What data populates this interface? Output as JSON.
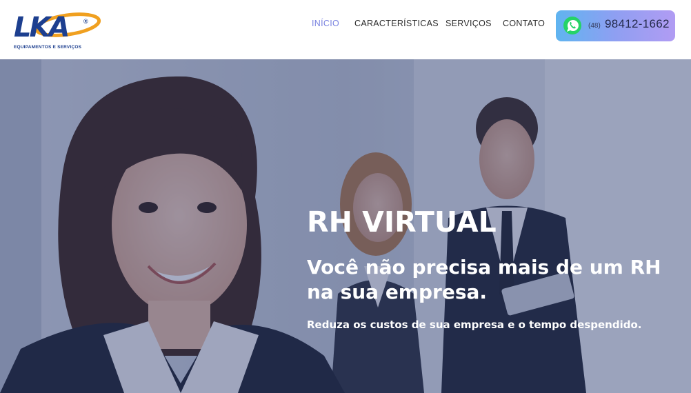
{
  "header": {
    "logo": {
      "letters": "LKA",
      "registered": "®",
      "tagline": "EQUIPAMENTOS E SERVIÇOS"
    },
    "nav": [
      {
        "label": "INÍCIO",
        "active": true
      },
      {
        "label": "CARACTERÍSTICAS",
        "active": false
      },
      {
        "label": "SERVIÇOS",
        "active": false
      },
      {
        "label": "CONTATO",
        "active": false
      }
    ],
    "phone": {
      "icon": "whatsapp-icon",
      "area_code": "(48)",
      "number": "98412-1662"
    }
  },
  "hero": {
    "title": "RH VIRTUAL",
    "subtitle": "Você não precisa mais de um RH na sua empresa.",
    "text": "Reduza os custos de sua empresa e o tempo despendido."
  },
  "colors": {
    "brand_blue": "#1d3f8f",
    "brand_orange": "#f0a020",
    "nav_active": "#7a83e0",
    "whatsapp_green": "#25d366",
    "hero_overlay": "#28376e"
  }
}
